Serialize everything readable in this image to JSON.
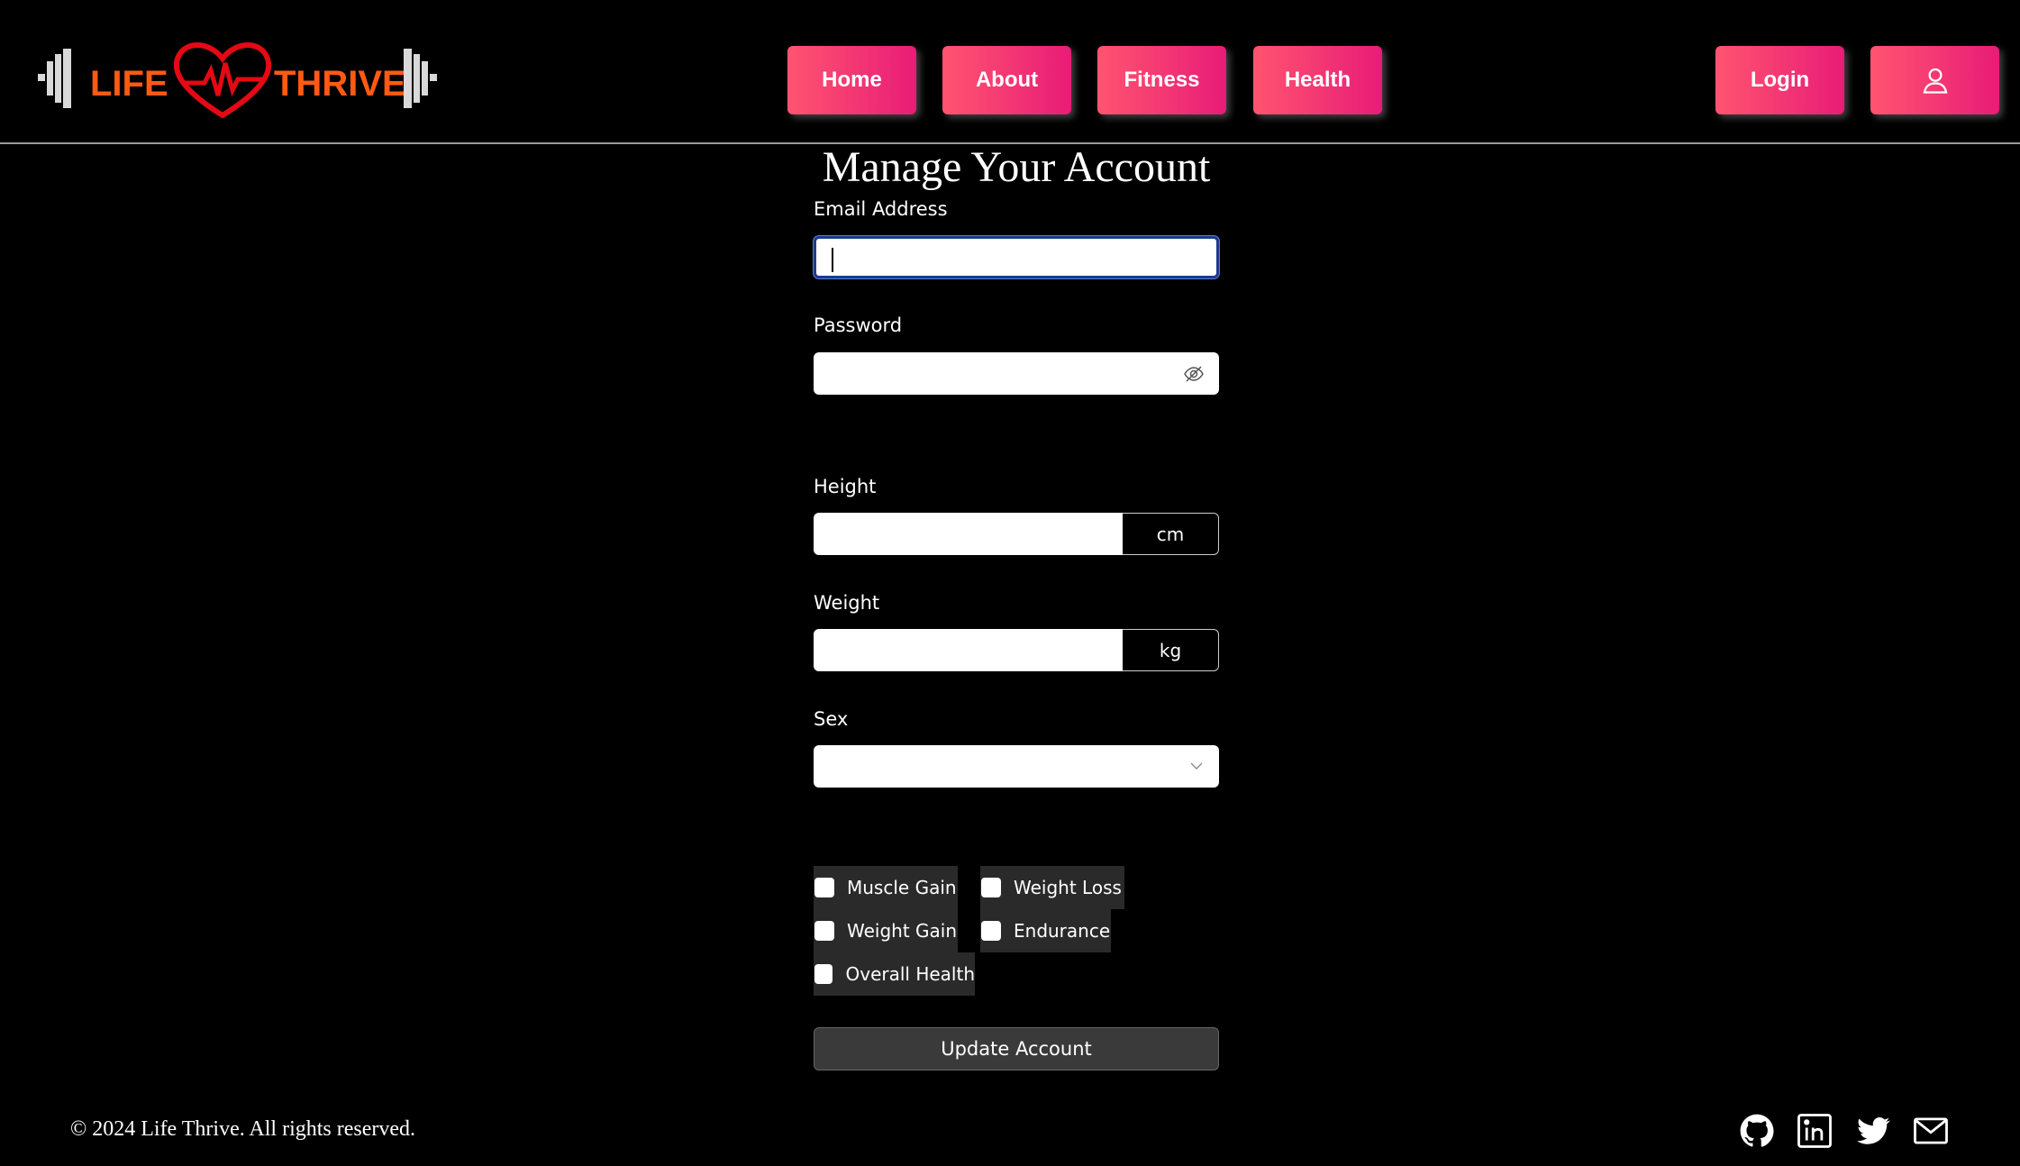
{
  "brand": {
    "left_word": "LIFE",
    "right_word": "THRIVE",
    "accent_color": "#ff5a14",
    "heart_color": "#e50914"
  },
  "nav": {
    "home": "Home",
    "about": "About",
    "fitness": "Fitness",
    "health": "Health",
    "login": "Login",
    "user_icon": "user-icon"
  },
  "form": {
    "title": "Manage Your Account",
    "email_label": "Email Address",
    "email_value": "",
    "password_label": "Password",
    "password_value": "",
    "height_label": "Height",
    "height_value": "",
    "height_unit": "cm",
    "weight_label": "Weight",
    "weight_value": "",
    "weight_unit": "kg",
    "sex_label": "Sex",
    "sex_value": "",
    "goals": [
      {
        "label": "Muscle Gain",
        "checked": false
      },
      {
        "label": "Weight Loss",
        "checked": false
      },
      {
        "label": "Weight Gain",
        "checked": false
      },
      {
        "label": "Endurance",
        "checked": false
      },
      {
        "label": "Overall Health",
        "checked": false
      }
    ],
    "submit_label": "Update Account"
  },
  "footer": {
    "copyright": "© 2024 Life Thrive. All rights reserved.",
    "social_icons": [
      "github-icon",
      "linkedin-icon",
      "twitter-icon",
      "mail-icon"
    ]
  },
  "colors": {
    "nav_gradient_start": "#ff5470",
    "nav_gradient_end": "#e81c77",
    "background": "#000000"
  }
}
